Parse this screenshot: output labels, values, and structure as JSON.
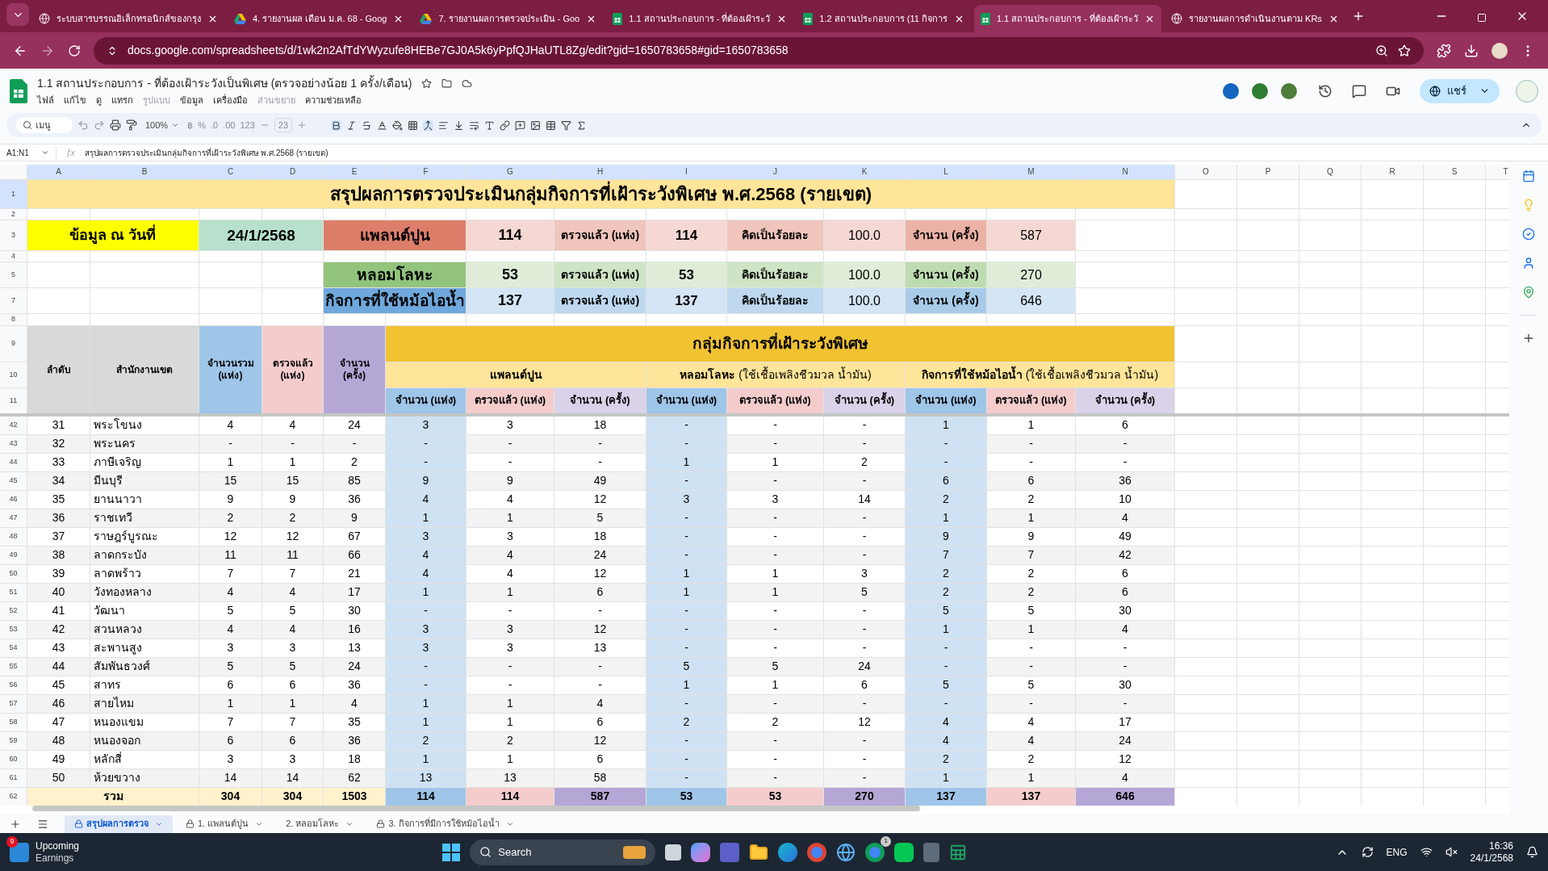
{
  "browser": {
    "tabs": [
      {
        "title": "ระบบสารบรรณอิเล็กทรอนิกส์ของกรุง",
        "kind": "globe",
        "selected": false
      },
      {
        "title": "4. รายงานผล เดือน ม.ค. 68 - Goog",
        "kind": "drive",
        "selected": false
      },
      {
        "title": "7. รายงานผลการตรวจประเมิน - Goo",
        "kind": "drive",
        "selected": false
      },
      {
        "title": "1.1 สถานประกอบการ - ที่ต้องเฝ้าระวั",
        "kind": "sheets",
        "selected": false
      },
      {
        "title": "1.2 สถานประกอบการ (11 กิจการ",
        "kind": "sheets",
        "selected": false
      },
      {
        "title": "1.1 สถานประกอบการ - ที่ต้องเฝ้าระวั",
        "kind": "sheets",
        "selected": true
      },
      {
        "title": "รายงานผลการดำเนินงานตาม KRs",
        "kind": "globe",
        "selected": false
      }
    ],
    "url": "docs.google.com/spreadsheets/d/1wk2n2AfTdYWyzufe8HEBe7GJ0A5k6yPpfQJHaUTL8Zg/edit?gid=1650783658#gid=1650783658"
  },
  "sheets": {
    "title": "1.1 สถานประกอบการ - ที่ต้องเฝ้าระวังเป็นพิเศษ (ตรวจอย่างน้อย 1 ครั้ง/เดือน)",
    "menu": [
      {
        "label": "ไฟล์",
        "disabled": false
      },
      {
        "label": "แก้ไข",
        "disabled": false
      },
      {
        "label": "ดู",
        "disabled": false
      },
      {
        "label": "แทรก",
        "disabled": false
      },
      {
        "label": "รูปแบบ",
        "disabled": true
      },
      {
        "label": "ข้อมูล",
        "disabled": false
      },
      {
        "label": "เครื่องมือ",
        "disabled": false
      },
      {
        "label": "ส่วนขยาย",
        "disabled": true
      },
      {
        "label": "ความช่วยเหลือ",
        "disabled": false
      }
    ],
    "share": "แชร์",
    "toolbar": {
      "search": "เมนู",
      "zoom": "100%",
      "currency": "฿",
      "percent": "%",
      "decimal_less": ".0",
      "decimal_more": ".00",
      "number_format": "123",
      "font_size": "23"
    },
    "name_box": "A1:N1",
    "fx": "ƒx",
    "formula": "สรุปผลการตรวจประเมินกลุ่มกิจการที่เฝ้าระวังพิเศษ  พ.ศ.2568 (รายเขต)"
  },
  "columns": [
    {
      "label": "A",
      "selected": true
    },
    {
      "label": "B",
      "selected": true
    },
    {
      "label": "C",
      "selected": true
    },
    {
      "label": "D",
      "selected": true
    },
    {
      "label": "E",
      "selected": true
    },
    {
      "label": "F",
      "selected": true
    },
    {
      "label": "G",
      "selected": true
    },
    {
      "label": "H",
      "selected": true
    },
    {
      "label": "I",
      "selected": true
    },
    {
      "label": "J",
      "selected": true
    },
    {
      "label": "K",
      "selected": true
    },
    {
      "label": "L",
      "selected": true
    },
    {
      "label": "M",
      "selected": true
    },
    {
      "label": "N",
      "selected": true
    },
    {
      "label": "O",
      "selected": false
    },
    {
      "label": "P",
      "selected": false
    },
    {
      "label": "Q",
      "selected": false
    },
    {
      "label": "R",
      "selected": false
    },
    {
      "label": "S",
      "selected": false
    },
    {
      "label": "T",
      "selected": false
    }
  ],
  "header_rows": [
    {
      "label": "1",
      "selected": true
    },
    {
      "label": "2",
      "selected": false
    },
    {
      "label": "3",
      "selected": false
    },
    {
      "label": "4",
      "selected": false
    },
    {
      "label": "5",
      "selected": false
    },
    {
      "label": "7",
      "selected": false
    },
    {
      "label": "8",
      "selected": false
    },
    {
      "label": "9",
      "selected": false
    },
    {
      "label": "10",
      "selected": false
    },
    {
      "label": "11",
      "selected": false
    }
  ],
  "title": "สรุปผลการตรวจประเมินกลุ่มกิจการที่เฝ้าระวังพิเศษ  พ.ศ.2568 (รายเขต)",
  "date_label": "ข้อมูล ณ วันที่",
  "date_value": "24/1/2568",
  "summary": [
    {
      "group": "แพลนต์ปูน",
      "color": "#dd7e6b",
      "total": "114",
      "checked_label": "ตรวจแล้ว (แห่ง)",
      "checked": "114",
      "percent_label": "คิดเป็นร้อยละ",
      "percent": "100.0",
      "count_label": "จำนวน (ครั้ง)",
      "count": "587"
    },
    {
      "group": "หลอมโลหะ",
      "color": "#93c47d",
      "total": "53",
      "checked_label": "ตรวจแล้ว (แห่ง)",
      "checked": "53",
      "percent_label": "คิดเป็นร้อยละ",
      "percent": "100.0",
      "count_label": "จำนวน (ครั้ง)",
      "count": "270"
    },
    {
      "group": "กิจการที่ใช้หม้อไอน้ำ",
      "color": "#6fa8dc",
      "total": "137",
      "checked_label": "ตรวจแล้ว (แห่ง)",
      "checked": "137",
      "percent_label": "คิดเป็นร้อยละ",
      "percent": "100.0",
      "count_label": "จำนวน (ครั้ง)",
      "count": "646"
    }
  ],
  "table": {
    "headers": [
      "ลำดับ",
      "สำนักงานเขต",
      "จำนวนรวม (แห่ง)",
      "ตรวจแล้ว (แห่ง)",
      "จำนวน (ครั้ง)"
    ],
    "group_title": "กลุ่มกิจการที่เฝ้าระวังพิเศษ",
    "subgroups": [
      {
        "name": "แพลนต์ปูน"
      },
      {
        "name": "หลอมโลหะ",
        "note": "(ใช้เชื้อเพลิงชีวมวล น้ำมัน)"
      },
      {
        "name": "กิจการที่ใช้หม้อไอน้ำ",
        "note": "(ใช้เชื้อเพลิงชีวมวล น้ำมัน)"
      }
    ],
    "subcolumns": [
      "จำนวน (แห่ง)",
      "ตรวจแล้ว (แห่ง)",
      "จำนวน (ครั้ง)",
      "จำนวน (แห่ง)",
      "ตรวจแล้ว (แห่ง)",
      "จำนวน (ครั้ง)",
      "จำนวน (แห่ง)",
      "ตรวจแล้ว (แห่ง)",
      "จำนวน (ครั้ง)"
    ],
    "rows": [
      {
        "row": "42",
        "no": "31",
        "office": "พระโขนง",
        "values": [
          "4",
          "4",
          "24",
          "3",
          "3",
          "18",
          "-",
          "-",
          "-",
          "1",
          "1",
          "6"
        ]
      },
      {
        "row": "43",
        "no": "32",
        "office": "พระนคร",
        "values": [
          "-",
          "-",
          "-",
          "-",
          "-",
          "-",
          "-",
          "-",
          "-",
          "-",
          "-",
          "-"
        ]
      },
      {
        "row": "44",
        "no": "33",
        "office": "ภาษีเจริญ",
        "values": [
          "1",
          "1",
          "2",
          "-",
          "-",
          "-",
          "1",
          "1",
          "2",
          "-",
          "-",
          "-"
        ]
      },
      {
        "row": "45",
        "no": "34",
        "office": "มีนบุรี",
        "values": [
          "15",
          "15",
          "85",
          "9",
          "9",
          "49",
          "-",
          "-",
          "-",
          "6",
          "6",
          "36"
        ]
      },
      {
        "row": "46",
        "no": "35",
        "office": "ยานนาวา",
        "values": [
          "9",
          "9",
          "36",
          "4",
          "4",
          "12",
          "3",
          "3",
          "14",
          "2",
          "2",
          "10"
        ]
      },
      {
        "row": "47",
        "no": "36",
        "office": "ราชเทวี",
        "values": [
          "2",
          "2",
          "9",
          "1",
          "1",
          "5",
          "-",
          "-",
          "-",
          "1",
          "1",
          "4"
        ]
      },
      {
        "row": "48",
        "no": "37",
        "office": "ราษฎร์บูรณะ",
        "values": [
          "12",
          "12",
          "67",
          "3",
          "3",
          "18",
          "-",
          "-",
          "-",
          "9",
          "9",
          "49"
        ]
      },
      {
        "row": "49",
        "no": "38",
        "office": "ลาดกระบัง",
        "values": [
          "11",
          "11",
          "66",
          "4",
          "4",
          "24",
          "-",
          "-",
          "-",
          "7",
          "7",
          "42"
        ]
      },
      {
        "row": "50",
        "no": "39",
        "office": "ลาดพร้าว",
        "values": [
          "7",
          "7",
          "21",
          "4",
          "4",
          "12",
          "1",
          "1",
          "3",
          "2",
          "2",
          "6"
        ]
      },
      {
        "row": "51",
        "no": "40",
        "office": "วังทองหลาง",
        "values": [
          "4",
          "4",
          "17",
          "1",
          "1",
          "6",
          "1",
          "1",
          "5",
          "2",
          "2",
          "6"
        ]
      },
      {
        "row": "52",
        "no": "41",
        "office": "วัฒนา",
        "values": [
          "5",
          "5",
          "30",
          "-",
          "-",
          "-",
          "-",
          "-",
          "-",
          "5",
          "5",
          "30"
        ]
      },
      {
        "row": "53",
        "no": "42",
        "office": "สวนหลวง",
        "values": [
          "4",
          "4",
          "16",
          "3",
          "3",
          "12",
          "-",
          "-",
          "-",
          "1",
          "1",
          "4"
        ]
      },
      {
        "row": "54",
        "no": "43",
        "office": "สะพานสูง",
        "values": [
          "3",
          "3",
          "13",
          "3",
          "3",
          "13",
          "-",
          "-",
          "-",
          "-",
          "-",
          "-"
        ]
      },
      {
        "row": "55",
        "no": "44",
        "office": "สัมพันธวงศ์",
        "values": [
          "5",
          "5",
          "24",
          "-",
          "-",
          "-",
          "5",
          "5",
          "24",
          "-",
          "-",
          "-"
        ]
      },
      {
        "row": "56",
        "no": "45",
        "office": "สาทร",
        "values": [
          "6",
          "6",
          "36",
          "-",
          "-",
          "-",
          "1",
          "1",
          "6",
          "5",
          "5",
          "30"
        ]
      },
      {
        "row": "57",
        "no": "46",
        "office": "สายไหม",
        "values": [
          "1",
          "1",
          "4",
          "1",
          "1",
          "4",
          "-",
          "-",
          "-",
          "-",
          "-",
          "-"
        ]
      },
      {
        "row": "58",
        "no": "47",
        "office": "หนองแขม",
        "values": [
          "7",
          "7",
          "35",
          "1",
          "1",
          "6",
          "2",
          "2",
          "12",
          "4",
          "4",
          "17"
        ]
      },
      {
        "row": "59",
        "no": "48",
        "office": "หนองจอก",
        "values": [
          "6",
          "6",
          "36",
          "2",
          "2",
          "12",
          "-",
          "-",
          "-",
          "4",
          "4",
          "24"
        ]
      },
      {
        "row": "60",
        "no": "49",
        "office": "หลักสี่",
        "values": [
          "3",
          "3",
          "18",
          "1",
          "1",
          "6",
          "-",
          "-",
          "-",
          "2",
          "2",
          "12"
        ]
      },
      {
        "row": "61",
        "no": "50",
        "office": "ห้วยขวาง",
        "values": [
          "14",
          "14",
          "62",
          "13",
          "13",
          "58",
          "-",
          "-",
          "-",
          "1",
          "1",
          "4"
        ]
      }
    ],
    "total": {
      "row": "62",
      "label": "รวม",
      "values": [
        "304",
        "304",
        "1503",
        "114",
        "114",
        "587",
        "53",
        "53",
        "270",
        "137",
        "137",
        "646"
      ]
    }
  },
  "sheet_tabs": [
    {
      "label": "สรุปผลการตรวจ",
      "selected": true,
      "locked": true
    },
    {
      "label": "1. แพลนต์ปูน",
      "selected": false,
      "locked": true
    },
    {
      "label": "2. หลอมโลหะ",
      "selected": false,
      "locked": false
    },
    {
      "label": "3. กิจการที่มีการใช้หม้อไอน้ำ",
      "selected": false,
      "locked": true
    }
  ],
  "taskbar": {
    "widget_badge": "9",
    "widget_title": "Upcoming",
    "widget_subtitle": "Earnings",
    "search": "Search",
    "chrome_badge": "1",
    "language": "ENG",
    "time": "16:36",
    "date": "24/1/2568"
  }
}
